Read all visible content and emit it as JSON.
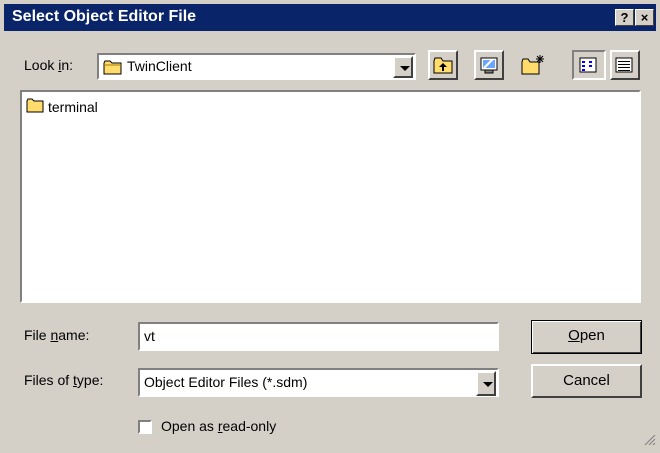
{
  "window": {
    "title": "Select Object Editor File",
    "help_label": "?",
    "close_label": "×"
  },
  "lookin": {
    "label_prefix": "Look ",
    "label_access": "i",
    "label_suffix": "n:",
    "value": "TwinClient"
  },
  "files": [
    {
      "name": "terminal",
      "icon": "folder-icon"
    }
  ],
  "filename": {
    "label_prefix": "File ",
    "label_access": "n",
    "label_suffix": "ame:",
    "value": "vt"
  },
  "filetype": {
    "label_prefix": "Files of ",
    "label_access": "t",
    "label_suffix": "ype:",
    "value": "Object Editor Files (*.sdm)"
  },
  "buttons": {
    "open_access": "O",
    "open_rest": "pen",
    "cancel": "Cancel"
  },
  "readonly": {
    "label_prefix": "Open as ",
    "label_access": "r",
    "label_suffix": "ead-only",
    "checked": false
  }
}
